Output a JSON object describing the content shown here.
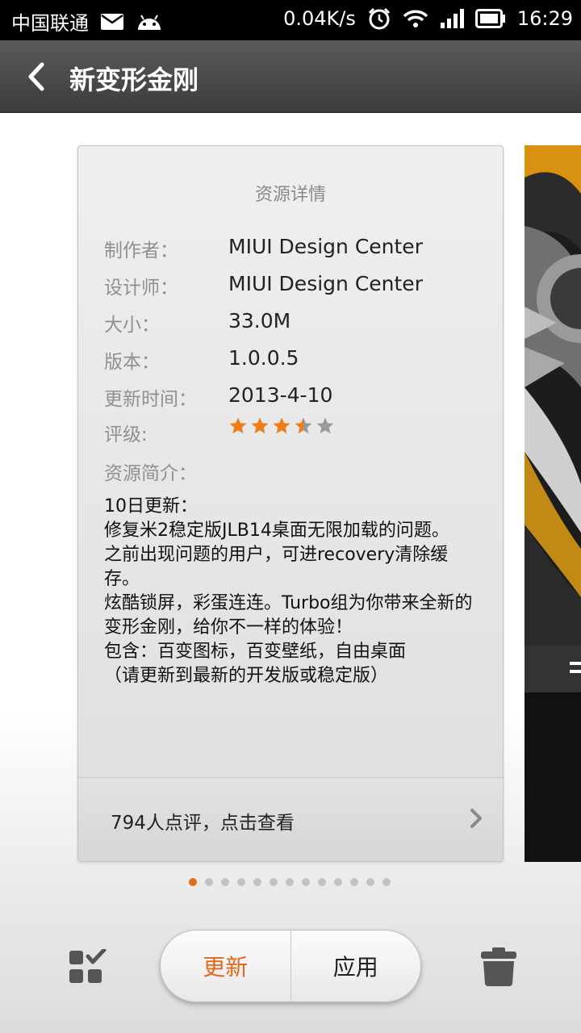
{
  "status_bar": {
    "carrier": "中国联通",
    "speed": "0.04K/s",
    "time": "16:29"
  },
  "header": {
    "title": "新变形金刚"
  },
  "detail": {
    "title": "资源详情",
    "rows": [
      {
        "label": "制作者：",
        "value": "MIUI Design Center"
      },
      {
        "label": "设计师：",
        "value": "MIUI Design Center"
      },
      {
        "label": "大小：",
        "value": "33.0M"
      },
      {
        "label": "版本：",
        "value": "1.0.0.5"
      },
      {
        "label": "更新时间：",
        "value": "2013-4-10"
      }
    ],
    "rating_label": "评级:",
    "rating": 3.5,
    "rating_max": 5,
    "intro_label": "资源简介：",
    "intro_text": "10日更新：\n修复米2稳定版JLB14桌面无限加载的问题。\n之前出现问题的用户，可进recovery清除缓存。\n炫酷锁屏，彩蛋连连。Turbo组为你带来全新的变形金刚，给你不一样的体验！\n包含：百变图标，百变壁纸，自由桌面\n（请更新到最新的开发版或稳定版）",
    "review_link": "794人点评，点击查看"
  },
  "pager": {
    "count": 13,
    "active_index": 0
  },
  "bottom": {
    "update_label": "更新",
    "apply_label": "应用"
  },
  "colors": {
    "accent": "#e3661a",
    "star_on": "#f07e18",
    "star_off": "#9a9a9a"
  }
}
